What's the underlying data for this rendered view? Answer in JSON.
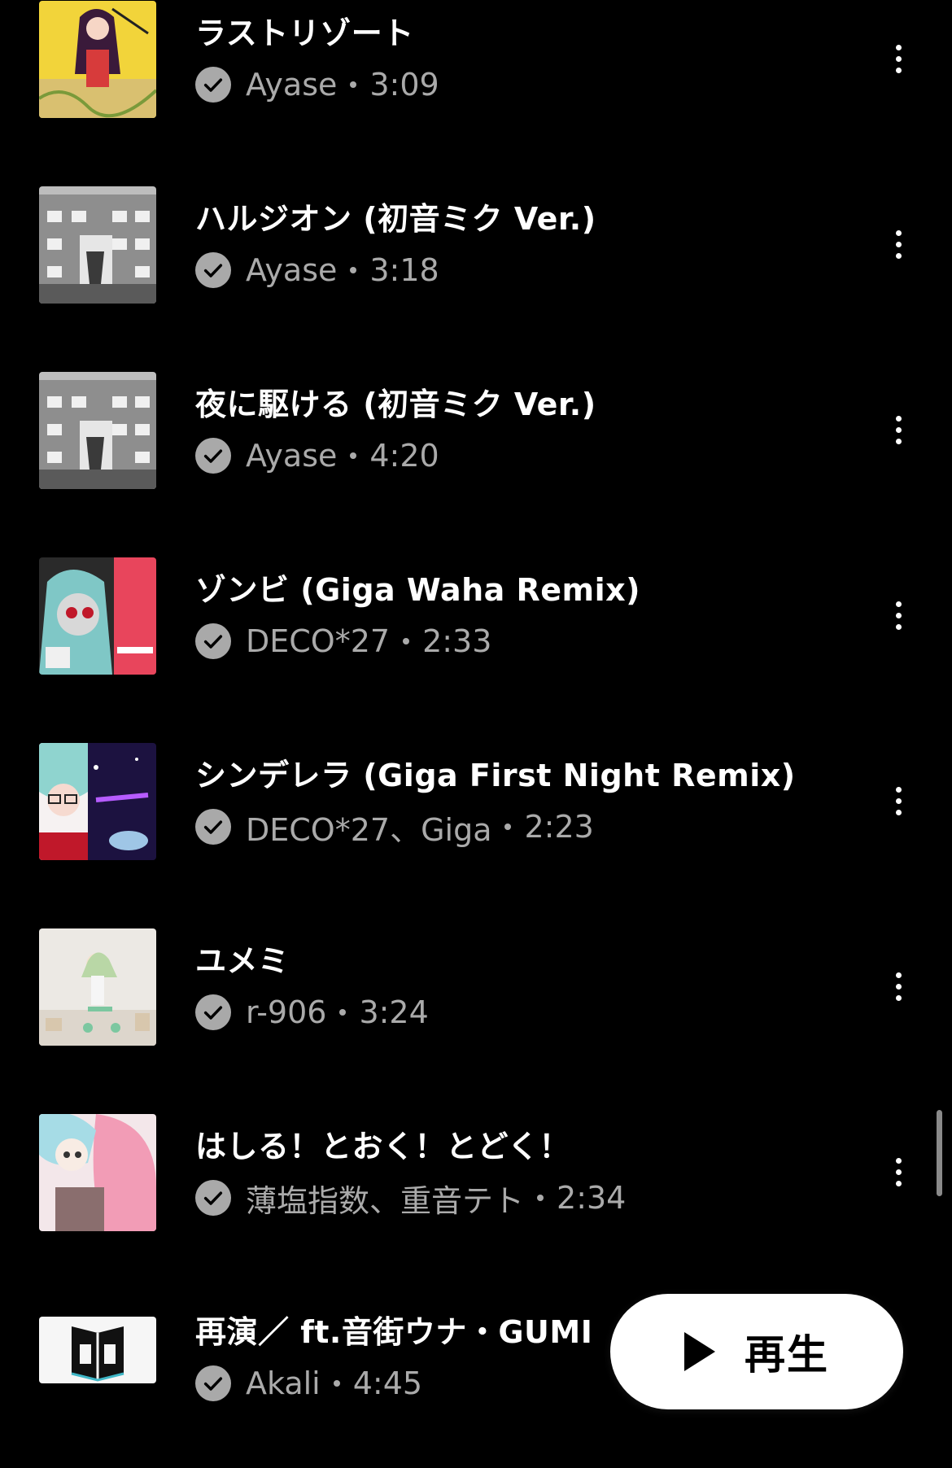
{
  "tracks": [
    {
      "title": "ラストリゾート",
      "artist": "Ayase",
      "duration": "3:09"
    },
    {
      "title": "ハルジオン (初音ミク Ver.)",
      "artist": "Ayase",
      "duration": "3:18"
    },
    {
      "title": "夜に駆ける (初音ミク Ver.)",
      "artist": "Ayase",
      "duration": "4:20"
    },
    {
      "title": "ゾンビ (Giga Waha Remix)",
      "artist": "DECO*27",
      "duration": "2:33"
    },
    {
      "title": "シンデレラ (Giga First Night Remix)",
      "artist": "DECO*27、Giga",
      "duration": "2:23"
    },
    {
      "title": "ユメミ",
      "artist": "r-906",
      "duration": "3:24"
    },
    {
      "title": "はしる！とおく！とどく！",
      "artist": "薄塩指数、重音テト",
      "duration": "2:34"
    },
    {
      "title": "再演／ ft.音街ウナ・GUMI",
      "artist": "Akali",
      "duration": "4:45"
    }
  ],
  "play_button": {
    "label": "再生"
  },
  "colors": {
    "background": "#000000",
    "secondary_text": "#aaaaaa",
    "check_badge": "#a9a9a9"
  }
}
